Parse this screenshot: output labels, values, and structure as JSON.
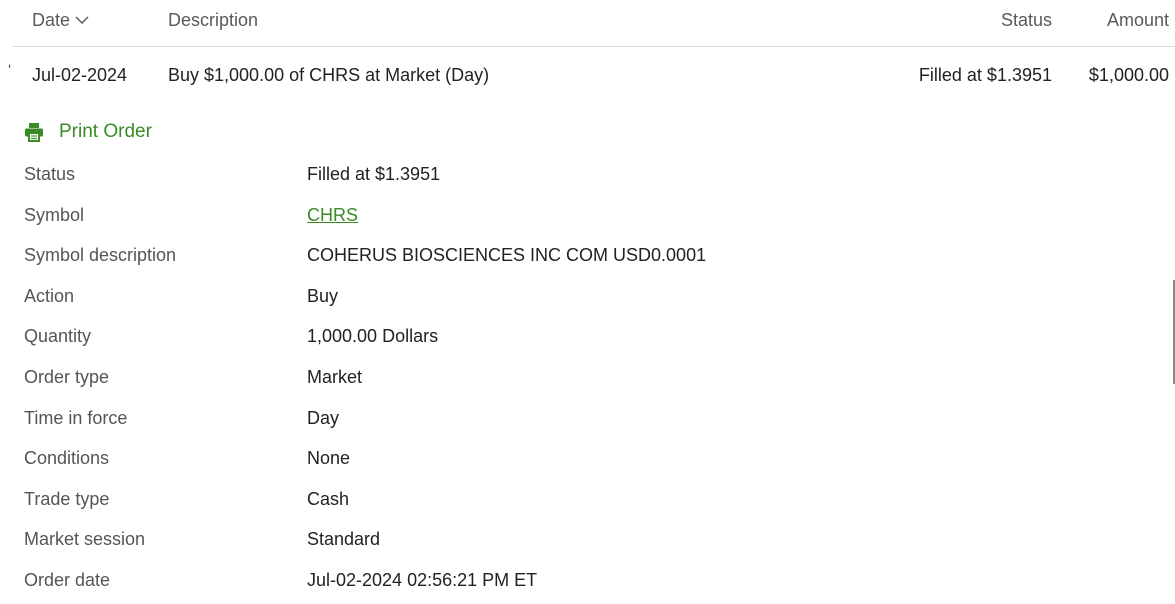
{
  "header": {
    "date_label": "Date",
    "description_label": "Description",
    "status_label": "Status",
    "amount_label": "Amount"
  },
  "order": {
    "date": "Jul-02-2024",
    "description": "Buy $1,000.00 of CHRS at Market (Day)",
    "status": "Filled at $1.3951",
    "amount": "$1,000.00"
  },
  "print_order_label": "Print Order",
  "details": [
    {
      "label": "Status",
      "value": "Filled at $1.3951"
    },
    {
      "label": "Symbol",
      "value": "CHRS"
    },
    {
      "label": "Symbol description",
      "value": "COHERUS BIOSCIENCES INC COM USD0.0001"
    },
    {
      "label": "Action",
      "value": "Buy"
    },
    {
      "label": "Quantity",
      "value": "1,000.00 Dollars"
    },
    {
      "label": "Order type",
      "value": "Market"
    },
    {
      "label": "Time in force",
      "value": "Day"
    },
    {
      "label": "Conditions",
      "value": "None"
    },
    {
      "label": "Trade type",
      "value": "Cash"
    },
    {
      "label": "Market session",
      "value": "Standard"
    },
    {
      "label": "Order date",
      "value": "Jul-02-2024 02:56:21 PM ET"
    }
  ],
  "colors": {
    "accent": "#3a8a26",
    "label_text": "#555555",
    "value_text": "#222222",
    "divider": "#dcdcdc"
  },
  "icons": {
    "sort": "chevron-down-icon",
    "print": "printer-icon"
  }
}
